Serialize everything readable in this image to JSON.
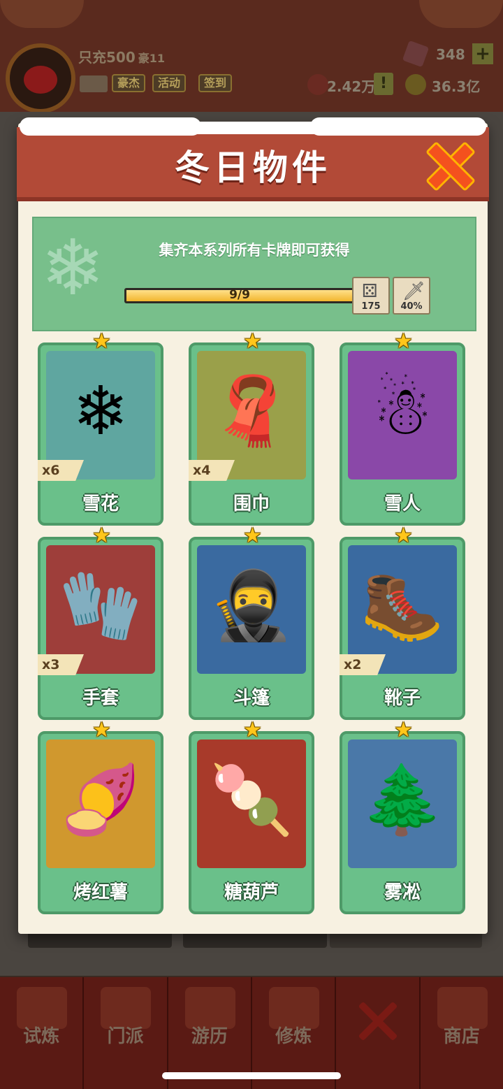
{
  "top_bar": {
    "player_name": "只充500",
    "vip_level": "豪11",
    "tags": [
      "豪杰",
      "活动",
      "签到"
    ],
    "gems": "348",
    "power": "2.42万",
    "coins": "36.3亿"
  },
  "modal": {
    "title": "冬日物件",
    "banner_text": "集齐本系列所有卡牌即可获得",
    "progress_text": "9/9",
    "progress_fraction": 1.0,
    "rewards": [
      {
        "icon": "dice-icon",
        "value": "175"
      },
      {
        "icon": "sword-icon",
        "value": "40%"
      }
    ]
  },
  "cards": [
    {
      "name": "雪花",
      "count": "x6",
      "icon": "snowflake-icon",
      "bg": "#5fa6a0"
    },
    {
      "name": "围巾",
      "count": "x4",
      "icon": "scarf-icon",
      "bg": "#9aa04a"
    },
    {
      "name": "雪人",
      "count": "",
      "icon": "snowman-icon",
      "bg": "#8a48a8"
    },
    {
      "name": "手套",
      "count": "x3",
      "icon": "gloves-icon",
      "bg": "#9e3e3a"
    },
    {
      "name": "斗篷",
      "count": "",
      "icon": "cloak-icon",
      "bg": "#3a6aa0"
    },
    {
      "name": "靴子",
      "count": "x2",
      "icon": "boots-icon",
      "bg": "#3a6aa0"
    },
    {
      "name": "烤红薯",
      "count": "",
      "icon": "sweet-potato-icon",
      "bg": "#d0982e"
    },
    {
      "name": "糖葫芦",
      "count": "",
      "icon": "tanghulu-icon",
      "bg": "#a83a2a"
    },
    {
      "name": "雾凇",
      "count": "",
      "icon": "rime-tree-icon",
      "bg": "#4a78a8"
    }
  ],
  "bottom_nav": [
    "试炼",
    "门派",
    "游历",
    "修炼",
    "",
    "商店"
  ]
}
